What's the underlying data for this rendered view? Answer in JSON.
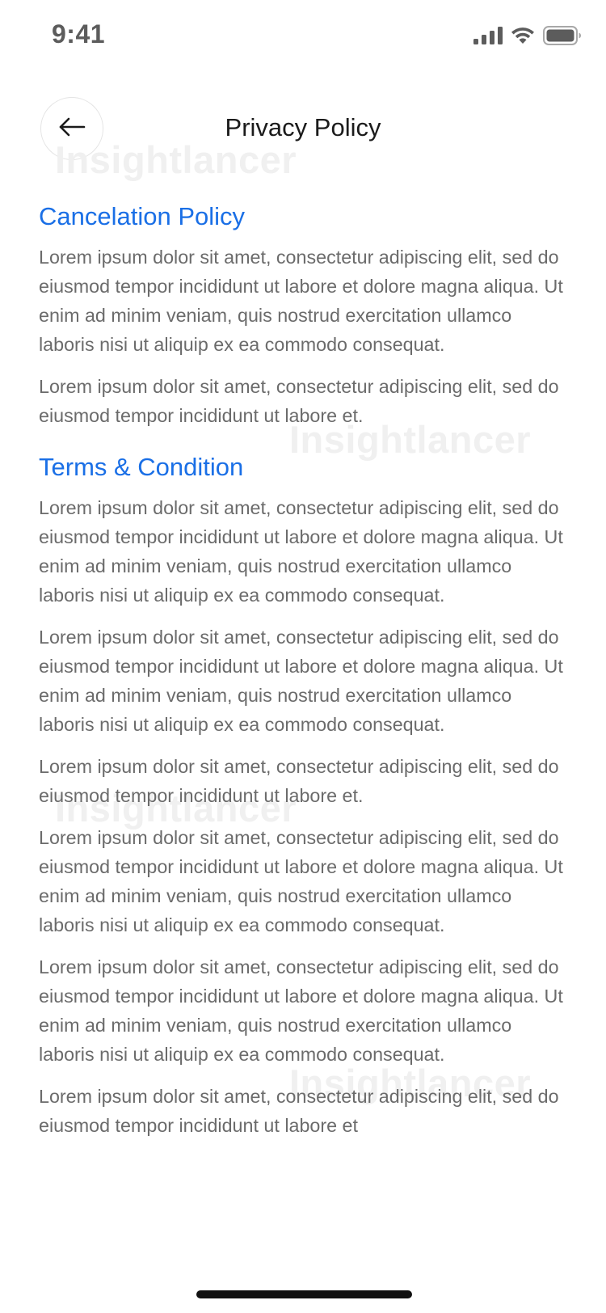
{
  "status_bar": {
    "time": "9:41",
    "icons": [
      "signal-icon",
      "wifi-icon",
      "battery-icon"
    ]
  },
  "header": {
    "title": "Privacy Policy",
    "back_icon": "arrow-left-icon"
  },
  "watermark": "Insightlancer",
  "sections": {
    "cancelation": {
      "title": "Cancelation Policy",
      "paragraphs": [
        "Lorem ipsum dolor sit amet, consectetur adipiscing elit, sed do eiusmod tempor incididunt ut labore et dolore magna aliqua. Ut enim ad minim veniam, quis nostrud exercitation ullamco laboris nisi ut aliquip ex ea commodo consequat.",
        "Lorem ipsum dolor sit amet, consectetur adipiscing elit, sed do eiusmod tempor incididunt ut labore et."
      ]
    },
    "terms": {
      "title": "Terms & Condition",
      "paragraphs": [
        "Lorem ipsum dolor sit amet, consectetur adipiscing elit, sed do eiusmod tempor incididunt ut labore et dolore magna aliqua. Ut enim ad minim veniam, quis nostrud exercitation ullamco laboris nisi ut aliquip ex ea commodo consequat.",
        "Lorem ipsum dolor sit amet, consectetur adipiscing elit, sed do eiusmod tempor incididunt ut labore et dolore magna aliqua. Ut enim ad minim veniam, quis nostrud exercitation ullamco laboris nisi ut aliquip ex ea commodo consequat.",
        "Lorem ipsum dolor sit amet, consectetur adipiscing elit, sed do eiusmod tempor incididunt ut labore et.",
        "Lorem ipsum dolor sit amet, consectetur adipiscing elit, sed do eiusmod tempor incididunt ut labore et dolore magna aliqua. Ut enim ad minim veniam, quis nostrud exercitation ullamco laboris nisi ut aliquip ex ea commodo consequat.",
        "Lorem ipsum dolor sit amet, consectetur adipiscing elit, sed do eiusmod tempor incididunt ut labore et dolore magna aliqua. Ut enim ad minim veniam, quis nostrud exercitation ullamco laboris nisi ut aliquip ex ea commodo consequat.",
        "Lorem ipsum dolor sit amet, consectetur adipiscing elit, sed do eiusmod tempor incididunt ut labore et"
      ]
    }
  },
  "colors": {
    "accent": "#1a6fe6",
    "body_text": "#6b6b6b",
    "title_text": "#1b1b1b",
    "watermark": "#f0f0f0"
  }
}
